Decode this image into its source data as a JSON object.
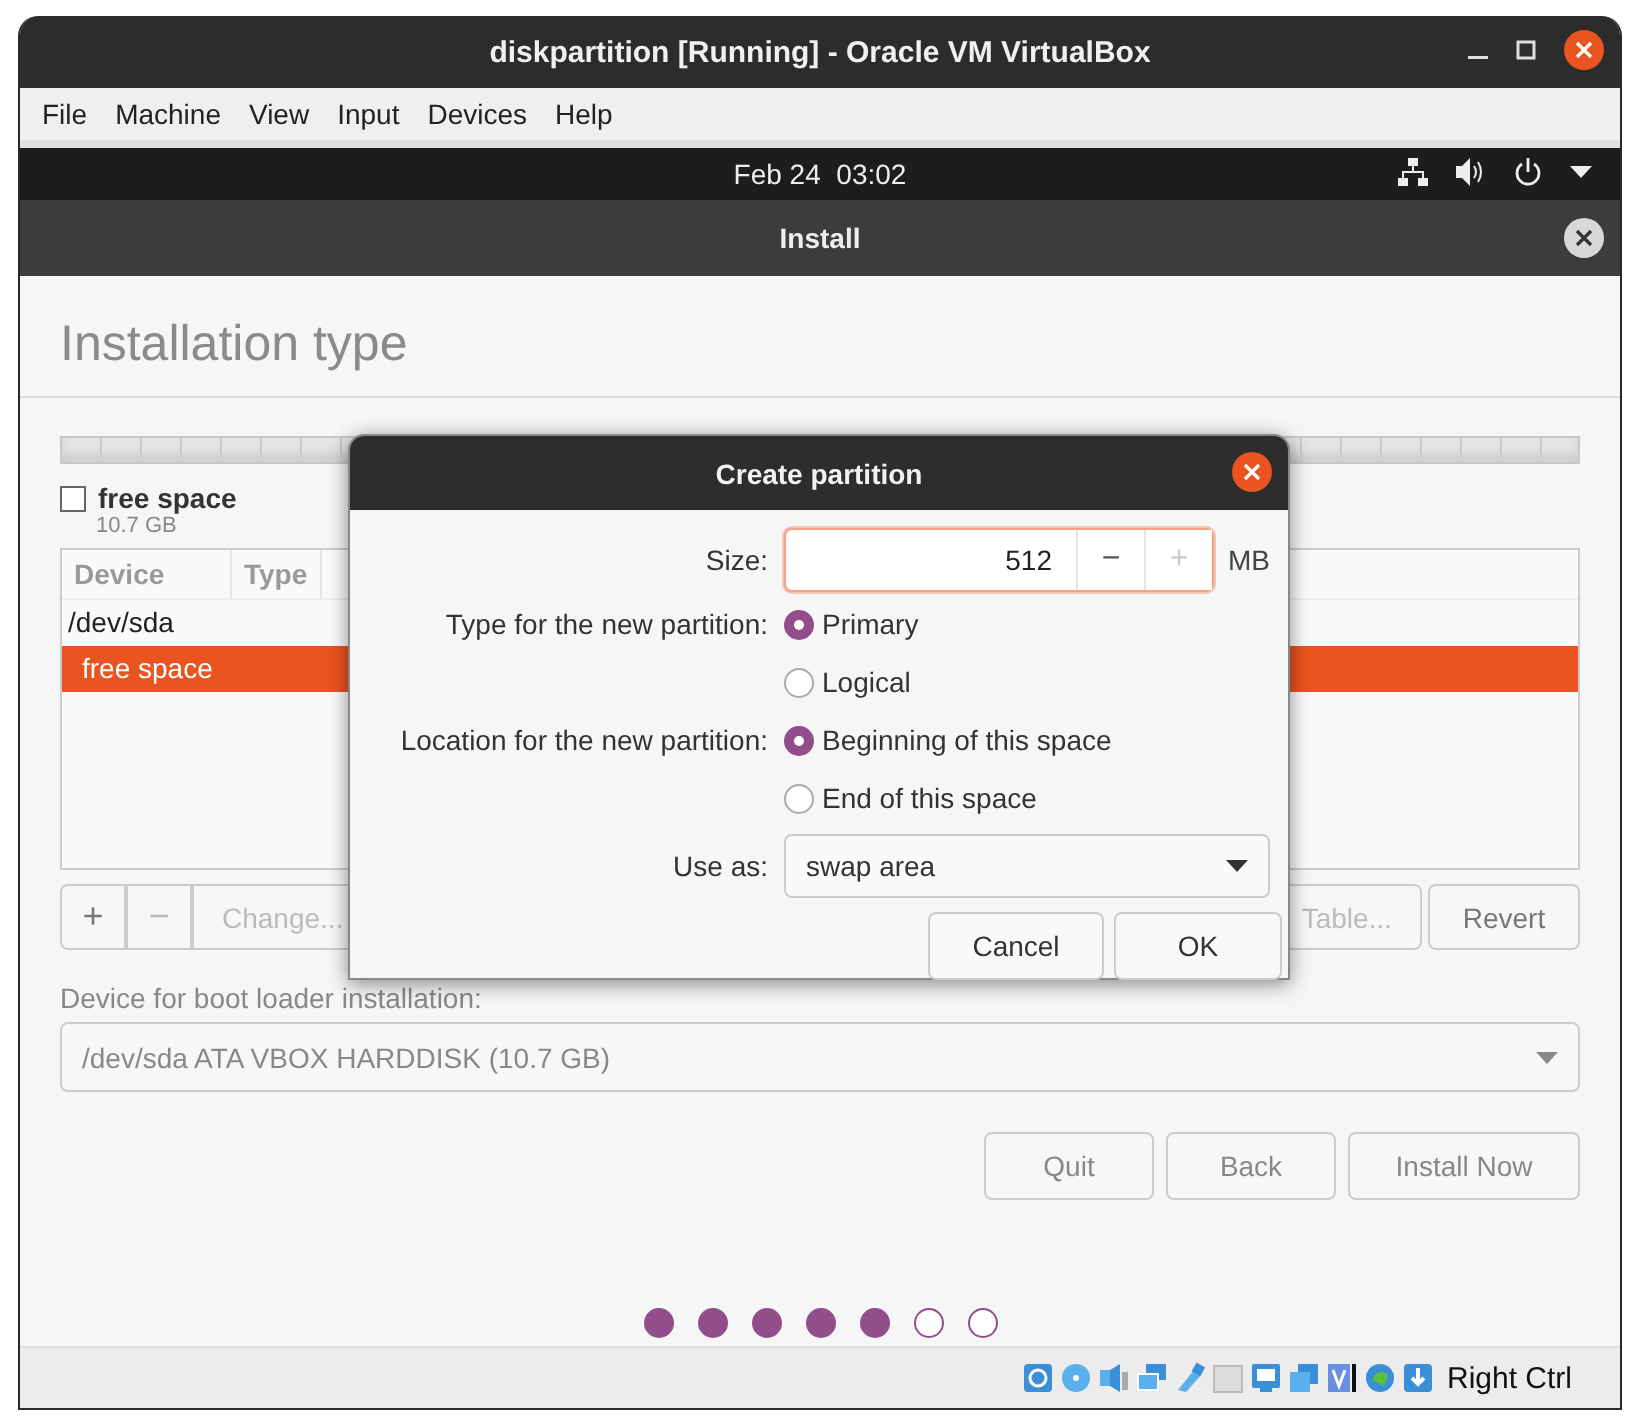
{
  "window": {
    "title": "diskpartition [Running] - Oracle VM VirtualBox"
  },
  "menu": [
    "File",
    "Machine",
    "View",
    "Input",
    "Devices",
    "Help"
  ],
  "top_bar": {
    "clock": "Feb 24  03:02"
  },
  "installer": {
    "title": "Install",
    "heading": "Installation type",
    "legend": {
      "label": "free space",
      "size": "10.7 GB",
      "checked": false
    },
    "table": {
      "columns": [
        "Device",
        "Type"
      ],
      "rows": [
        {
          "device": "/dev/sda",
          "selected": false
        },
        {
          "device": "free space",
          "selected": true
        }
      ]
    },
    "toolbar": [
      {
        "kind": "icon",
        "label": "+",
        "disabled": false
      },
      {
        "kind": "icon",
        "label": "−",
        "disabled": true
      },
      {
        "kind": "text",
        "label": "Change...",
        "disabled": true
      },
      {
        "kind": "text",
        "label": "Table...",
        "disabled": true
      },
      {
        "kind": "text",
        "label": "Revert",
        "disabled": false
      }
    ],
    "boot_loader": {
      "label": "Device for boot loader installation:",
      "value": "/dev/sda ATA VBOX HARDDISK (10.7 GB)"
    },
    "buttons": [
      "Quit",
      "Back",
      "Install Now"
    ],
    "progress_dots": [
      {
        "done": true
      },
      {
        "done": true
      },
      {
        "done": true
      },
      {
        "done": true
      },
      {
        "done": true
      },
      {
        "done": false
      },
      {
        "done": false
      }
    ]
  },
  "dialog": {
    "title": "Create partition",
    "size": {
      "label": "Size:",
      "value": "512",
      "decrement": "−",
      "increment": "+",
      "increment_disabled": true,
      "unit": "MB"
    },
    "type": {
      "label": "Type for the new partition:",
      "options": [
        {
          "label": "Primary",
          "selected": true
        },
        {
          "label": "Logical",
          "selected": false
        }
      ]
    },
    "location": {
      "label": "Location for the new partition:",
      "options": [
        {
          "label": "Beginning of this space",
          "selected": true
        },
        {
          "label": "End of this space",
          "selected": false
        }
      ]
    },
    "use_as": {
      "label": "Use as:",
      "value": "swap area"
    },
    "buttons": [
      "Cancel",
      "OK"
    ]
  },
  "status_bar": {
    "host_key": "Right Ctrl"
  }
}
